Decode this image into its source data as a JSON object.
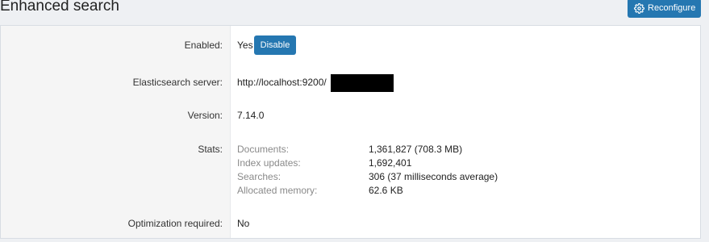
{
  "header": {
    "title": "Enhanced search",
    "reconfigure_label": "Reconfigure",
    "reconfigure_icon": "gear-icon"
  },
  "rows": {
    "enabled": {
      "label": "Enabled:",
      "value": "Yes",
      "button_label": "Disable"
    },
    "server": {
      "label": "Elasticsearch server:",
      "value": "http://localhost:9200/"
    },
    "version": {
      "label": "Version:",
      "value": "7.14.0"
    },
    "stats": {
      "label": "Stats:",
      "items": [
        {
          "label": "Documents:",
          "value": "1,361,827 (708.3 MB)"
        },
        {
          "label": "Index updates:",
          "value": "1,692,401"
        },
        {
          "label": "Searches:",
          "value": "306 (37 milliseconds average)"
        },
        {
          "label": "Allocated memory:",
          "value": "62.6 KB"
        }
      ]
    },
    "optimization": {
      "label": "Optimization required:",
      "value": "No"
    }
  },
  "colors": {
    "accent": "#2577b1",
    "label_column_bg": "#f5f5f5",
    "redaction": "#000000"
  }
}
